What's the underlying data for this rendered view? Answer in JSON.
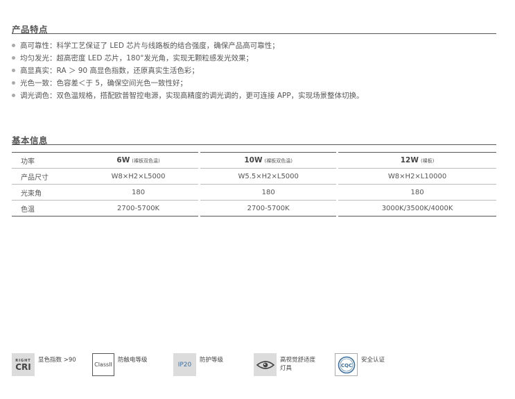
{
  "features_section": {
    "title": "产品特点",
    "items": [
      "高可靠性：科学工艺保证了 LED 芯片与线路板的结合强度，确保产品高可靠性；",
      "均匀发光：超高密度 LED 芯片，180°发光角，实现无颗粒感发光效果；",
      "高显真实：RA ＞ 90 高显色指数，还原真实生活色彩；",
      "光色一致：色容差＜于 5，确保空间光色一致性好；",
      "调光调色：双色温规格，搭配欧普智控电源，实现高精度的调光调的，更可连接 APP，实现场景整体切换。"
    ]
  },
  "info_section": {
    "title": "基本信息",
    "table": {
      "header_label": "功率",
      "columns": [
        {
          "main": "6W",
          "sub": "(裸板双色温)"
        },
        {
          "main": "10W",
          "sub": "(裸板双色温)"
        },
        {
          "main": "12W",
          "sub": "(裸板)"
        }
      ],
      "rows": [
        {
          "label": "产品尺寸",
          "values": [
            "W8×H2×L5000",
            "W5.5×H2×L5000",
            "W8×H2×L10000"
          ]
        },
        {
          "label": "光束角",
          "values": [
            "180",
            "180",
            "180"
          ]
        },
        {
          "label": "色温",
          "values": [
            "2700-5700K",
            "2700-5700K",
            "3000K/3500K/4000K"
          ]
        }
      ]
    }
  },
  "badges": {
    "cri": {
      "small": "RIGHT",
      "big": "CRI",
      "label": "显色指数 >90"
    },
    "class": {
      "icon_text": "ClassII",
      "label": "防触电等级"
    },
    "ip": {
      "icon_text": "IP20",
      "label": "防护等级"
    },
    "eye": {
      "label_line1": "高视觉舒适度",
      "label_line2": "灯具"
    },
    "cqc": {
      "icon_text": "CQC",
      "label": "安全认证"
    }
  }
}
